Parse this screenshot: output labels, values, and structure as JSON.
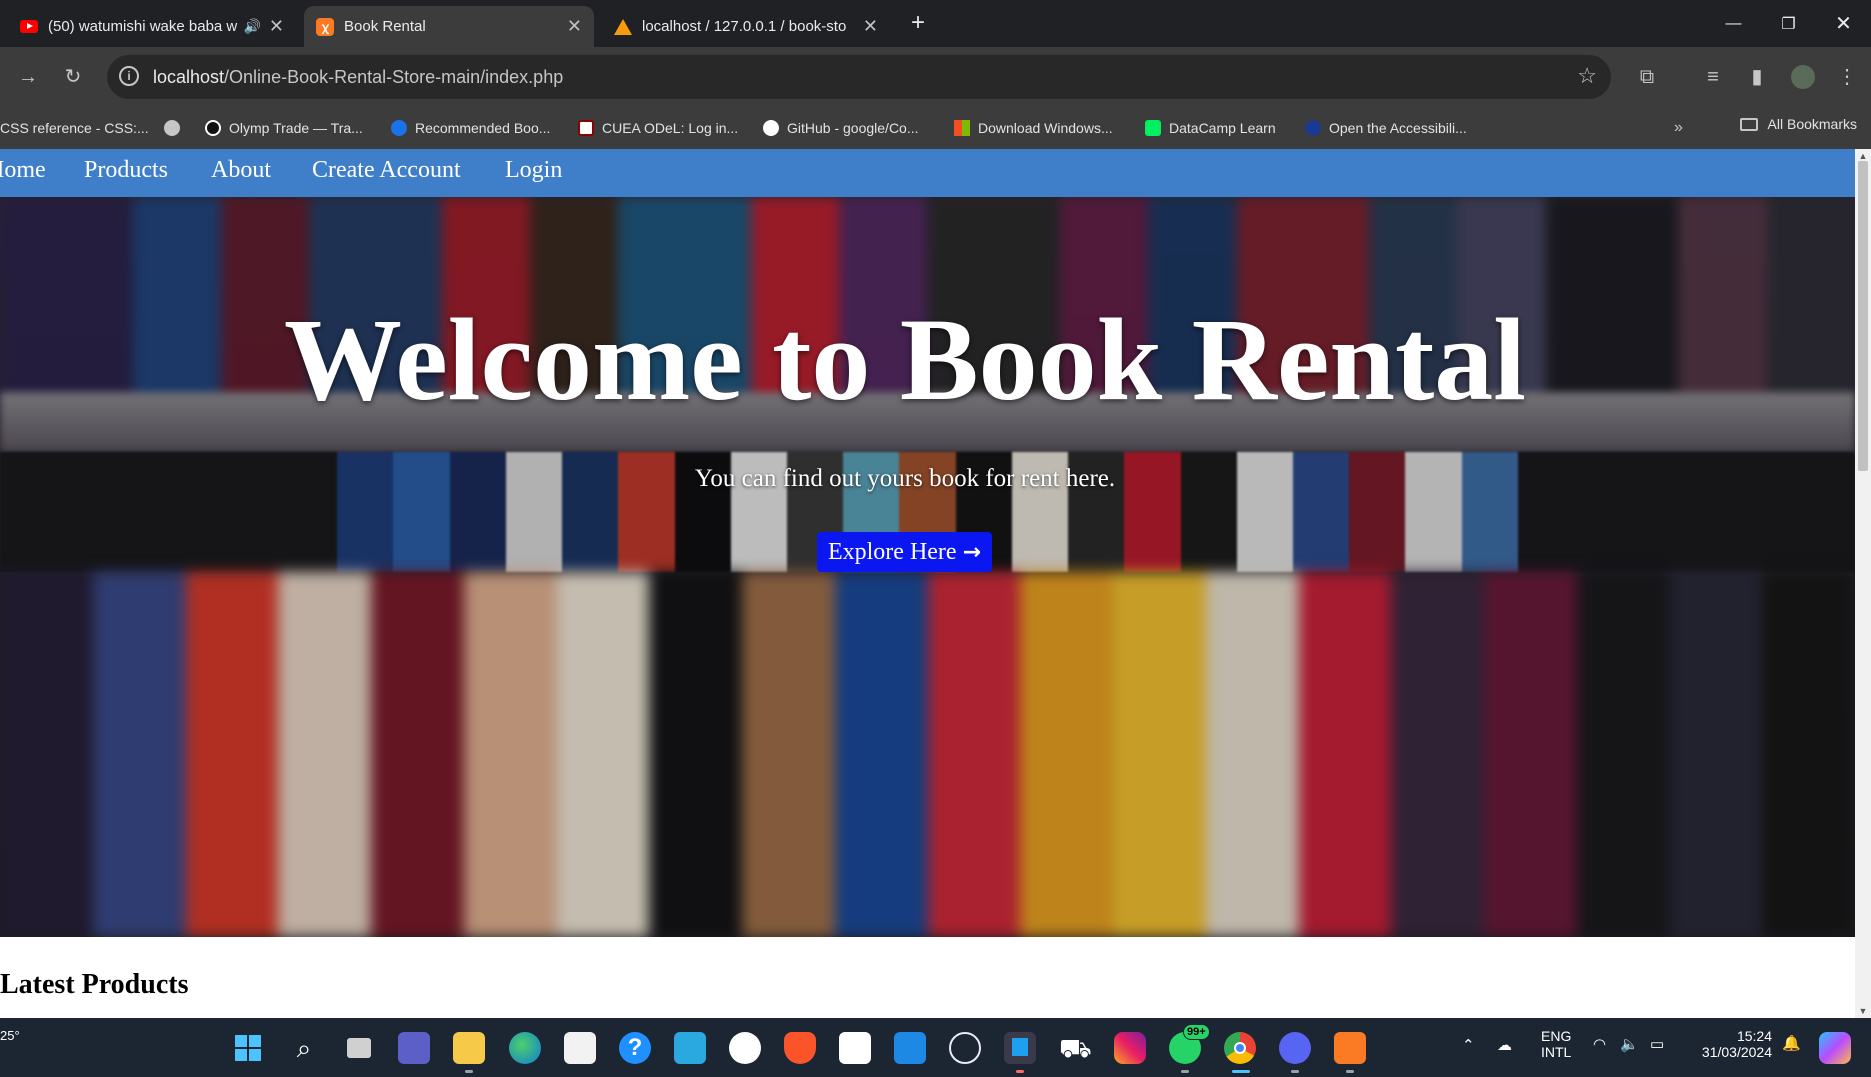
{
  "browser": {
    "tabs": [
      {
        "title": "(50) watumishi wake baba w",
        "icon": "youtube-icon",
        "audio": true
      },
      {
        "title": "Book Rental",
        "icon": "xampp-icon",
        "active": true
      },
      {
        "title": "localhost / 127.0.0.1 / book-sto",
        "icon": "phpmyadmin-icon"
      }
    ],
    "new_tab": "+",
    "url_host": "localhost",
    "url_path": "/Online-Book-Rental-Store-main/index.php",
    "bookmarks": [
      {
        "label": "CSS reference - CSS:...",
        "color": "#e8eaed"
      },
      {
        "label": "",
        "icon": "globe-icon",
        "color": "#c4c7c5"
      },
      {
        "label": "Olymp Trade — Tra...",
        "color": "#ffffff"
      },
      {
        "label": "Recommended Boo...",
        "color": "#1a73e8"
      },
      {
        "label": "CUEA ODeL: Log in...",
        "color": "#8b0000"
      },
      {
        "label": "GitHub - google/Co...",
        "color": "#ffffff"
      },
      {
        "label": "Download Windows...",
        "color": "#f25022"
      },
      {
        "label": "DataCamp Learn",
        "color": "#03ef62"
      },
      {
        "label": "Open the Accessibili...",
        "color": "#1a3a8f"
      }
    ],
    "all_bookmarks": "All Bookmarks"
  },
  "nav": {
    "items": [
      "Home",
      "Products",
      "About",
      "Create Account",
      "Login"
    ]
  },
  "hero": {
    "title": "Welcome to Book Rental",
    "subtitle": "You can find out yours book for rent here.",
    "button": "Explore Here",
    "button_color": "#0a17f0"
  },
  "section": {
    "latest": "Latest Products"
  },
  "taskbar": {
    "weather": "25°",
    "lang": "ENG",
    "layout": "INTL",
    "time": "15:24",
    "date": "31/03/2024",
    "whatsapp_badge": "99+"
  },
  "colors": {
    "navbar": "#3f7fc9",
    "chrome_dark": "#202124",
    "toolbar": "#3c3c3c"
  }
}
